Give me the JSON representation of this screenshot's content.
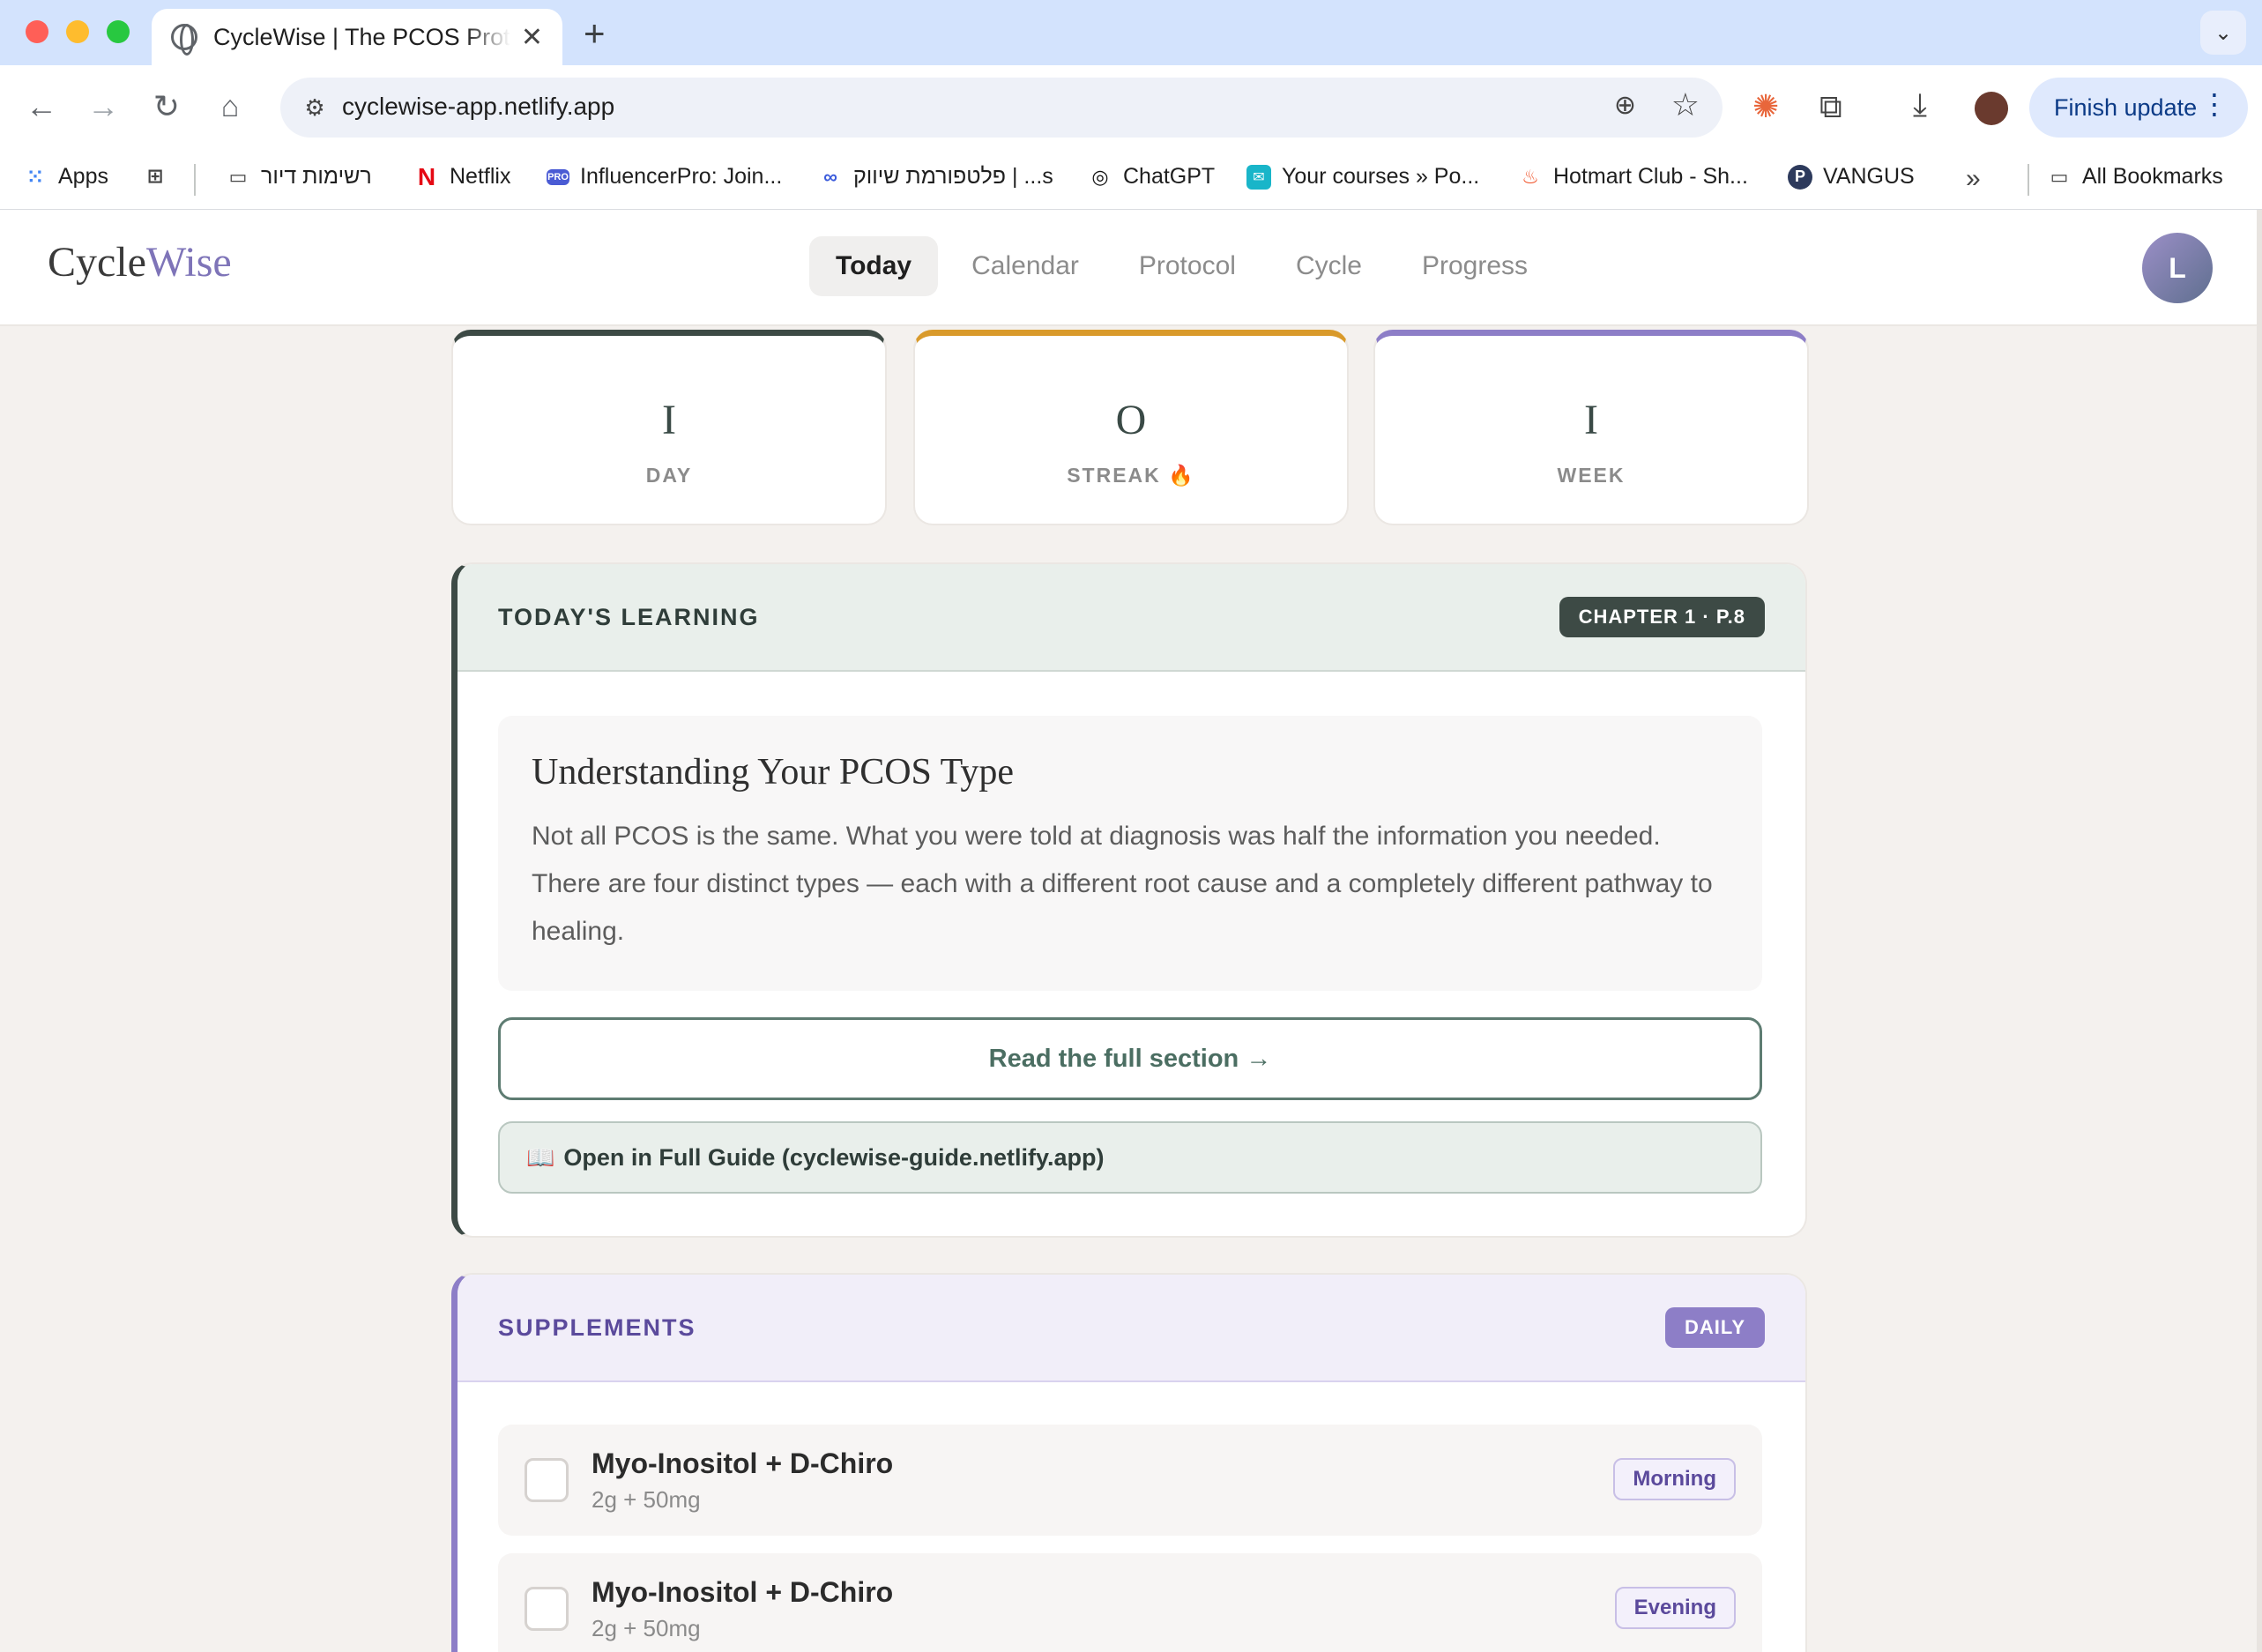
{
  "browser": {
    "tab_title": "CycleWise | The PCOS Protocol",
    "url": "cyclewise-app.netlify.app",
    "finish_update": "Finish update",
    "bookmarks": [
      {
        "label": "Apps",
        "icon": "apps-grid-icon"
      },
      {
        "label": "",
        "icon": "tab-groups-icon"
      },
      {
        "label": "רשימות דיור",
        "icon": "folder-icon"
      },
      {
        "label": "Netflix",
        "icon": "netflix-icon"
      },
      {
        "label": "InfluencerPro: Join...",
        "icon": "influencerpro-icon"
      },
      {
        "label": "פלטפורמת שיווק | ...s",
        "icon": "link-icon"
      },
      {
        "label": "ChatGPT",
        "icon": "chatgpt-icon"
      },
      {
        "label": "Your courses » Po...",
        "icon": "courses-icon"
      },
      {
        "label": "Hotmart Club - Sh...",
        "icon": "hotmart-icon"
      },
      {
        "label": "VANGUS",
        "icon": "vangus-icon"
      },
      {
        "label": "All Bookmarks",
        "icon": "folder-icon"
      }
    ]
  },
  "app": {
    "logo_part1": "Cycle",
    "logo_part2": "Wise",
    "nav": [
      "Today",
      "Calendar",
      "Protocol",
      "Cycle",
      "Progress"
    ],
    "active_nav": "Today",
    "avatar_initial": "L",
    "stats": [
      {
        "value": "I",
        "label": "DAY",
        "accent": "#3d4a45"
      },
      {
        "value": "O",
        "label": "STREAK 🔥",
        "accent": "#d99a2b"
      },
      {
        "value": "I",
        "label": "WEEK",
        "accent": "#8d7ec7"
      }
    ],
    "learning": {
      "title": "TODAY'S LEARNING",
      "badge": "CHAPTER 1 · P.8",
      "lesson_title": "Understanding Your PCOS Type",
      "lesson_body": "Not all PCOS is the same. What you were told at diagnosis was half the information you needed. There are four distinct types — each with a different root cause and a completely different pathway to healing.",
      "read_button": "Read the full section →",
      "guide_button": "Open in Full Guide (cyclewise-guide.netlify.app)"
    },
    "supplements": {
      "title": "SUPPLEMENTS",
      "badge": "DAILY",
      "items": [
        {
          "name": "Myo-Inositol + D-Chiro",
          "dose": "2g + 50mg",
          "time": "Morning"
        },
        {
          "name": "Myo-Inositol + D-Chiro",
          "dose": "2g + 50mg",
          "time": "Evening"
        }
      ]
    }
  }
}
